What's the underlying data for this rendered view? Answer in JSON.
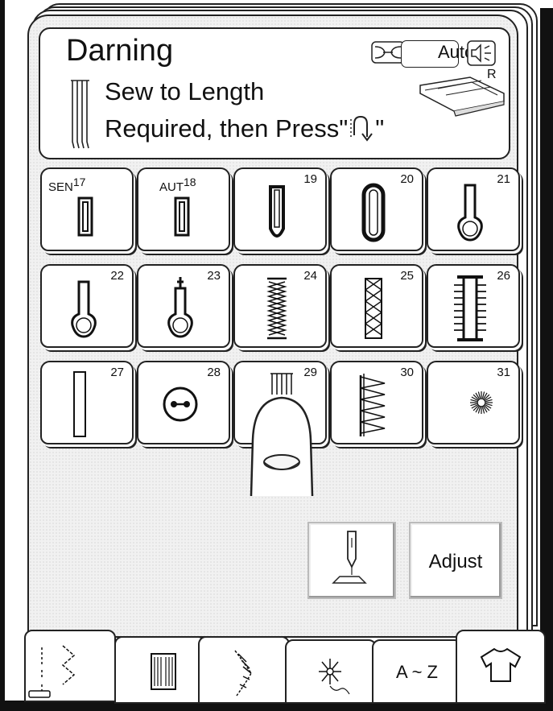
{
  "message": {
    "title": "Darning",
    "line1": "Sew to Length",
    "line2": "Required, then Press\"",
    "quote_close": "\"",
    "auto_label": "Auto",
    "foot_letter": "R"
  },
  "stitches": [
    {
      "num": "17",
      "prefix": "SEN",
      "icon": "narrow-rectangle-icon"
    },
    {
      "num": "18",
      "prefix": "AUT",
      "icon": "narrow-rectangle-icon"
    },
    {
      "num": "19",
      "icon": "rounded-rectangle-icon"
    },
    {
      "num": "20",
      "icon": "tall-oval-icon"
    },
    {
      "num": "21",
      "icon": "keyhole-icon"
    },
    {
      "num": "22",
      "icon": "keyhole-icon"
    },
    {
      "num": "23",
      "icon": "keyhole-with-bar-icon"
    },
    {
      "num": "24",
      "icon": "zigzag-column-icon"
    },
    {
      "num": "25",
      "icon": "cross-hatch-column-icon"
    },
    {
      "num": "26",
      "icon": "bartack-ladder-icon"
    },
    {
      "num": "27",
      "icon": "rectangle-icon"
    },
    {
      "num": "28",
      "icon": "button-sew-icon"
    },
    {
      "num": "29",
      "icon": "darning-lines-icon"
    },
    {
      "num": "30",
      "icon": "zigzag-tack-icon"
    },
    {
      "num": "31",
      "icon": "eyelet-icon"
    }
  ],
  "adjust_label": "Adjust",
  "tabs": [
    {
      "icon": "utility-stitch-icon"
    },
    {
      "icon": "buttonhole-icon"
    },
    {
      "icon": "satin-stitch-icon"
    },
    {
      "icon": "decorative-flower-icon"
    },
    {
      "label": "A ~ Z",
      "icon": "alphabet-icon"
    },
    {
      "icon": "garment-icon"
    }
  ]
}
